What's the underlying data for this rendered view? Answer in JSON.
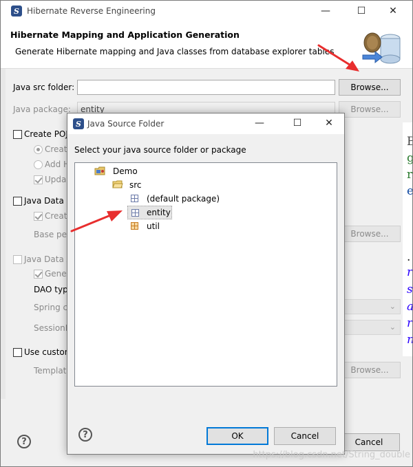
{
  "main": {
    "title": "Hibernate Reverse Engineering",
    "header_title": "Hibernate Mapping and Application Generation",
    "header_desc": "Generate Hibernate mapping and Java classes from database explorer tables",
    "java_src_label": "Java src folder:",
    "java_src_value": "",
    "browse_label": "Browse...",
    "java_package_label": "Java package:",
    "java_package_value": "entity",
    "create_pojo_label": "Create POJ",
    "create_label": "Creat",
    "add_label": "Add H",
    "update_label": "Upda",
    "java_data_label": "Java Data O",
    "create2_label": "Creat",
    "base_label": "Base pe",
    "java_data_a_label": "Java Data A",
    "gene_label": "Gener",
    "dao_label": "DAO typ",
    "spring_label": "Spring c",
    "session_label": "SessionF",
    "use_custom_label": "Use custon",
    "template_label": "Templat",
    "cancel_label": "Cancel",
    "help_symbol": "?"
  },
  "dialog": {
    "title": "Java Source Folder",
    "prompt": "Select your java source folder or package",
    "tree": {
      "project": "Demo",
      "folder": "src",
      "packages": [
        "(default package)",
        "entity",
        "util"
      ]
    },
    "ok_label": "OK",
    "cancel_label": "Cancel",
    "help_symbol": "?"
  },
  "window_controls": {
    "minimize": "—",
    "maximize": "☐",
    "close": "✕"
  },
  "editor_fragments": [
    "B",
    "g",
    "r",
    "e",
    ".",
    "r",
    "s",
    "a",
    "r",
    "n"
  ],
  "watermark": "https://blog.csdn.net/String_double",
  "colors": {
    "accent": "#0078d7",
    "selection": "#e5e5e5",
    "arrow": "#e82e2e",
    "header_bg": "#ffffff",
    "window_bg": "#f0f0f0"
  },
  "icons": {
    "app": "hibernate-app-icon",
    "project": "java-project-icon",
    "folder": "source-folder-icon",
    "package": "package-icon",
    "help": "help-icon",
    "banner": "database-banner-icon"
  }
}
